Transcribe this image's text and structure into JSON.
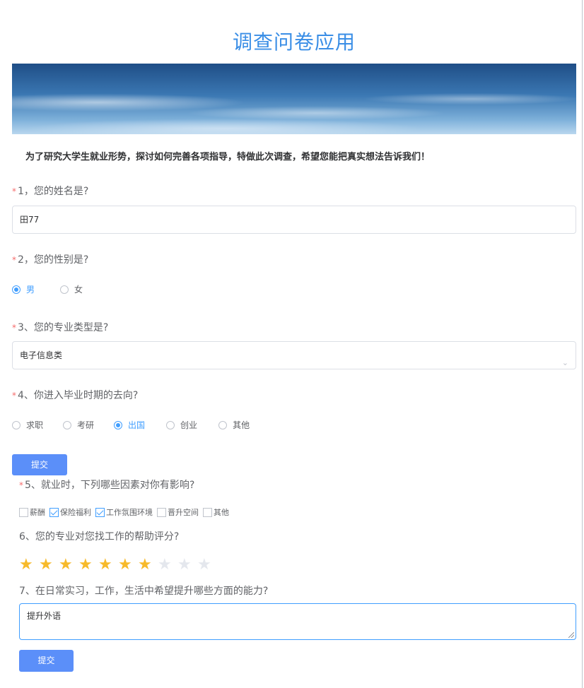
{
  "title": "调查问卷应用",
  "intro": "为了研究大学生就业形势，探讨如何完善各项指导，特做此次调查，希望您能把真实想法告诉我们！",
  "required_mark": "*",
  "q1": {
    "label": "1，您的姓名是?",
    "value": "田77"
  },
  "q2": {
    "label": "2，您的性别是?",
    "options": [
      "男",
      "女"
    ],
    "selected": "男"
  },
  "q3": {
    "label": "3、您的专业类型是?",
    "value": "电子信息类",
    "arrow": "chevron-down"
  },
  "q4": {
    "label": "4、你进入毕业时期的去向?",
    "options": [
      "求职",
      "考研",
      "出国",
      "创业",
      "其他"
    ],
    "selected": "出国"
  },
  "submit1": "提交",
  "q5": {
    "label": "5、就业时，下列哪些因素对你有影响?",
    "options": [
      {
        "label": "薪酬",
        "checked": false
      },
      {
        "label": "保险福利",
        "checked": true
      },
      {
        "label": "工作氛围环境",
        "checked": true
      },
      {
        "label": "晋升空间",
        "checked": false
      },
      {
        "label": "其他",
        "checked": false
      }
    ]
  },
  "q6": {
    "label": "6、您的专业对您找工作的帮助评分?",
    "rating": 7,
    "max": 10,
    "star_glyph": "★"
  },
  "q7": {
    "label": "7、在日常实习，工作，生活中希望提升哪些方面的能力?",
    "value": "提升外语"
  },
  "submit2": "提交",
  "colors": {
    "accent": "#409eff",
    "button": "#5b8ff9",
    "required": "#f56c6c",
    "star": "#f7ba2a"
  }
}
